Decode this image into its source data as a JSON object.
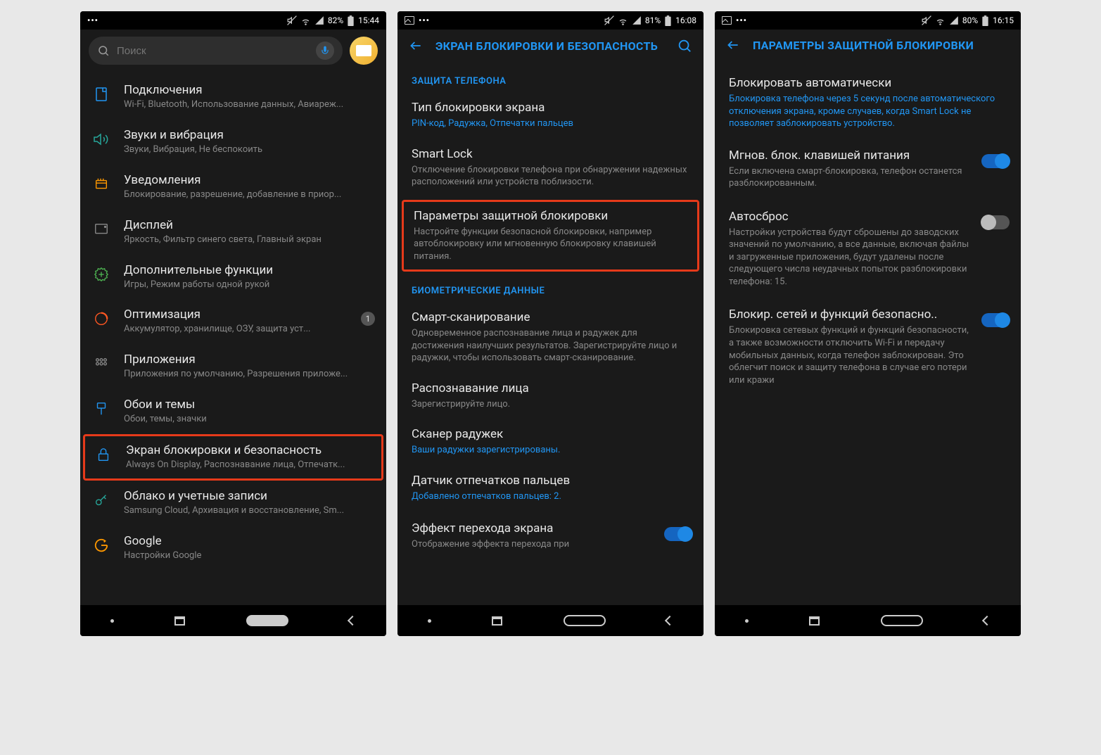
{
  "screen1": {
    "status": {
      "battery": "82%",
      "time": "15:44"
    },
    "search_placeholder": "Поиск",
    "items": [
      {
        "title": "Подключения",
        "sub": "Wi-Fi, Bluetooth, Использование данных, Авиареж..."
      },
      {
        "title": "Звуки и вибрация",
        "sub": "Звуки, Вибрация, Не беспокоить"
      },
      {
        "title": "Уведомления",
        "sub": "Блокирование, разрешение, добавление в приор..."
      },
      {
        "title": "Дисплей",
        "sub": "Яркость, Фильтр синего света, Главный экран"
      },
      {
        "title": "Дополнительные функции",
        "sub": "Игры, Режим работы одной рукой"
      },
      {
        "title": "Оптимизация",
        "sub": "Аккумулятор, хранилище, ОЗУ, защита уст...",
        "badge": "1"
      },
      {
        "title": "Приложения",
        "sub": "Приложения по умолчанию, Разрешения приложе..."
      },
      {
        "title": "Обои и темы",
        "sub": "Обои, темы, значки"
      },
      {
        "title": "Экран блокировки и безопасность",
        "sub": "Always On Display, Распознавание лица, Отпечатк..."
      },
      {
        "title": "Облако и учетные записи",
        "sub": "Samsung Cloud, Архивация и восстановление, Sm..."
      },
      {
        "title": "Google",
        "sub": "Настройки Google"
      }
    ]
  },
  "screen2": {
    "status": {
      "battery": "81%",
      "time": "16:08"
    },
    "title": "ЭКРАН БЛОКИРОВКИ И БЕЗОПАСНОСТЬ",
    "section1": "ЗАЩИТА ТЕЛЕФОНА",
    "items1": [
      {
        "title": "Тип блокировки экрана",
        "sub": "PIN-код, Радужка, Отпечатки пальцев",
        "blue": true
      },
      {
        "title": "Smart Lock",
        "sub": "Отключение блокировки телефона при обнаружении надежных расположений или устройств поблизости."
      },
      {
        "title": "Параметры защитной блокировки",
        "sub": "Настройте функции безопасной блокировки, например автоблокировку или мгновенную блокировку клавишей питания."
      }
    ],
    "section2": "БИОМЕТРИЧЕСКИЕ ДАННЫЕ",
    "items2": [
      {
        "title": "Смарт-сканирование",
        "sub": "Одновременное распознавание лица и радужек для достижения наилучших результатов. Зарегистрируйте лицо и радужки, чтобы использовать смарт-сканирование."
      },
      {
        "title": "Распознавание лица",
        "sub": "Зарегистрируйте лицо."
      },
      {
        "title": "Сканер радужек",
        "sub": "Ваши радужки зарегистрированы.",
        "blue": true
      },
      {
        "title": "Датчик отпечатков пальцев",
        "sub": "Добавлено отпечатков пальцев: 2.",
        "blue": true
      }
    ],
    "effect": {
      "title": "Эффект перехода экрана",
      "sub": "Отображение эффекта перехода при"
    }
  },
  "screen3": {
    "status": {
      "battery": "80%",
      "time": "16:15"
    },
    "title": "ПАРАМЕТРЫ ЗАЩИТНОЙ БЛОКИРОВКИ",
    "items": [
      {
        "title": "Блокировать автоматически",
        "sub": "Блокировка телефона через 5 секунд после автоматического отключения экрана, кроме случаев, когда Smart Lock не позволяет заблокировать устройство.",
        "blue": true,
        "toggle": null
      },
      {
        "title": "Мгнов. блок. клавишей питания",
        "sub": "Если включена смарт-блокировка, телефон останется разблокированным.",
        "toggle": true
      },
      {
        "title": "Автосброс",
        "sub": "Настройки устройства будут сброшены до заводских значений по умолчанию, а все данные, включая файлы и загруженные приложения, будут удалены после следующего числа неудачных попыток разблокировки телефона: 15.",
        "toggle": false
      },
      {
        "title": "Блокир. сетей и функций безопасно..",
        "sub": "Блокировка сетевых функций и функций безопасности, а также возможности отключить Wi-Fi и передачу мобильных данных, когда телефон заблокирован. Это облегчит поиск и защиту телефона в случае его потери или кражи",
        "toggle": true
      }
    ]
  }
}
